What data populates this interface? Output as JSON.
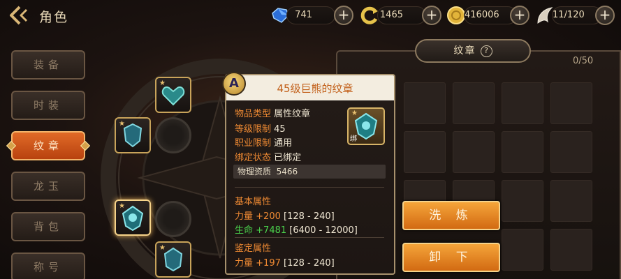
{
  "header": {
    "title": "角色"
  },
  "resources": [
    {
      "name": "gem",
      "value": "741"
    },
    {
      "name": "refresh-coin",
      "value": "1465"
    },
    {
      "name": "gold-coin",
      "value": "416006"
    },
    {
      "name": "stamina",
      "value": "11/120"
    }
  ],
  "menu": {
    "items": [
      {
        "label": "装备"
      },
      {
        "label": "时装"
      },
      {
        "label": "纹章"
      },
      {
        "label": "龙玉"
      },
      {
        "label": "背包"
      },
      {
        "label": "称号"
      }
    ],
    "active_index": 2
  },
  "panel": {
    "tab_label": "纹章",
    "help_symbol": "?",
    "count": "0/50"
  },
  "tooltip": {
    "badge": "A",
    "title": "45级巨熊的纹章",
    "fields": [
      {
        "label": "物品类型",
        "value": "属性纹章"
      },
      {
        "label": "等级限制",
        "value": "45"
      },
      {
        "label": "职业限制",
        "value": "通用"
      },
      {
        "label": "绑定状态",
        "value": "已绑定"
      }
    ],
    "icon_tag": "绑",
    "quality": {
      "label": "物理资质",
      "value": "5466"
    },
    "base_section": "基本属性",
    "base_stats": [
      {
        "name": "力量",
        "bonus": "+200",
        "range": "[128 - 240]"
      },
      {
        "name": "生命",
        "bonus": "+7481",
        "range": "[6400 - 12000]"
      }
    ],
    "appraise_section": "鉴定属性",
    "appraise_stats": [
      {
        "name": "力量",
        "bonus": "+197",
        "range": "[128 - 240]"
      }
    ]
  },
  "actions": {
    "refine_label": "洗 炼",
    "unequip_label": "卸 下"
  },
  "colors": {
    "accent_orange": "#e06a27",
    "title_orange": "#c2601a",
    "stat_green": "#4ad14b",
    "gold_border": "#f6d38a"
  }
}
